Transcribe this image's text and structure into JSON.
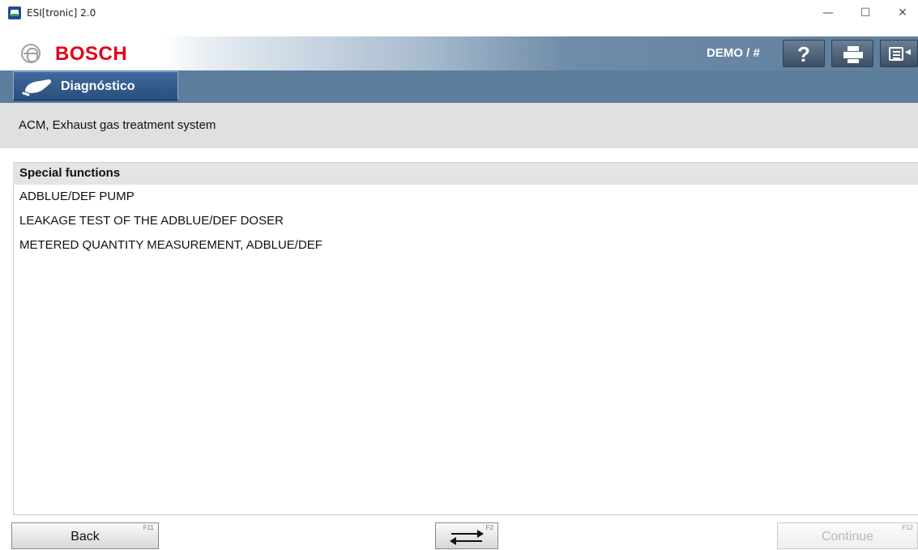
{
  "window": {
    "title": "ESI[tronic] 2.0",
    "minimize": "—",
    "maximize": "☐",
    "close": "✕"
  },
  "header": {
    "brand": "BOSCH",
    "user_label": "DEMO / #",
    "help_glyph": "?",
    "icons": [
      "bosch-logo-icon",
      "help-icon",
      "print-icon",
      "menu-icon"
    ]
  },
  "tab": {
    "label": "Diagnóstico",
    "icon": "car-diagnostic-icon"
  },
  "breadcrumb": {
    "text": "ACM, Exhaust gas treatment system"
  },
  "list": {
    "header": "Special functions",
    "items": [
      "ADBLUE/DEF PUMP",
      "LEAKAGE TEST OF THE ADBLUE/DEF DOSER",
      "METERED QUANTITY MEASUREMENT, ADBLUE/DEF"
    ]
  },
  "footer": {
    "back_label": "Back",
    "back_key": "F11",
    "swap_key": "F2",
    "continue_label": "Continue",
    "continue_key": "F12"
  },
  "colors": {
    "brand_red": "#e2001a",
    "header_blue": "#5d7d9c",
    "tab_blue": "#2a4f7e"
  }
}
